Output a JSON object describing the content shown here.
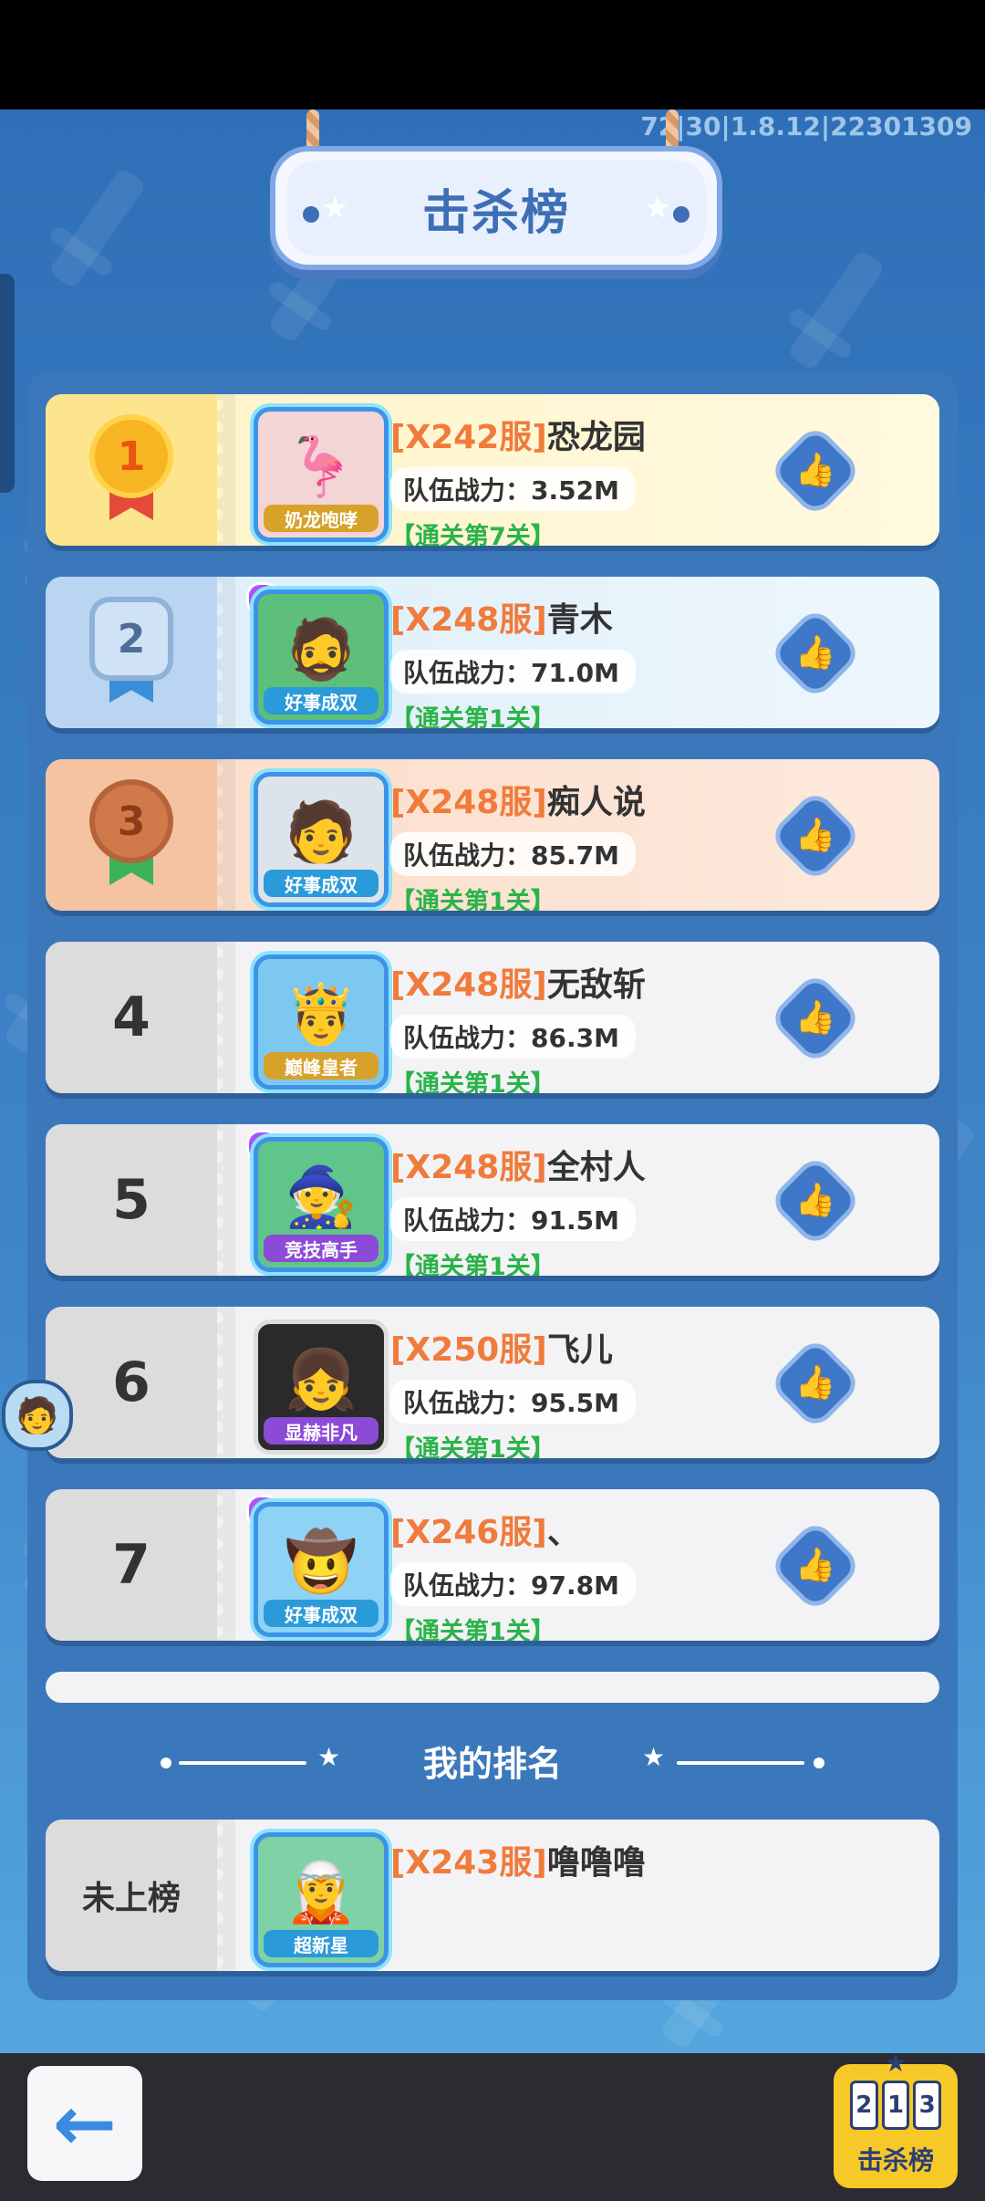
{
  "version": "72|30|1.8.12|22301309",
  "title": "击杀榜",
  "power_prefix": "队伍战力：",
  "rows": [
    {
      "rank": "1",
      "server": "[X242服]",
      "name": "恐龙园",
      "power": "3.52M",
      "stage": "【通关第7关】",
      "badge": "奶龙咆哮",
      "tier": "gold",
      "emoji": "🦩"
    },
    {
      "rank": "2",
      "server": "[X248服]",
      "name": "青木",
      "power": "71.0M",
      "stage": "【通关第1关】",
      "badge": "好事成双",
      "tier": "silver",
      "emoji": "🧔"
    },
    {
      "rank": "3",
      "server": "[X248服]",
      "name": "痴人说",
      "power": "85.7M",
      "stage": "【通关第1关】",
      "badge": "好事成双",
      "tier": "bronze",
      "emoji": "🧑"
    },
    {
      "rank": "4",
      "server": "[X248服]",
      "name": "无敌斩",
      "power": "86.3M",
      "stage": "【通关第1关】",
      "badge": "巅峰皇者",
      "tier": "plain",
      "emoji": "🤴"
    },
    {
      "rank": "5",
      "server": "[X248服]",
      "name": "全村人",
      "power": "91.5M",
      "stage": "【通关第1关】",
      "badge": "竞技高手",
      "tier": "plain",
      "emoji": "🧙"
    },
    {
      "rank": "6",
      "server": "[X250服]",
      "name": "飞儿",
      "power": "95.5M",
      "stage": "【通关第1关】",
      "badge": "显赫非凡",
      "tier": "plain",
      "emoji": "👧"
    },
    {
      "rank": "7",
      "server": "[X246服]",
      "name": "、",
      "power": "97.8M",
      "stage": "【通关第1关】",
      "badge": "好事成双",
      "tier": "plain",
      "emoji": "🤠"
    }
  ],
  "my_rank": {
    "title": "我的排名",
    "rank_text": "未上榜",
    "server": "[X243服]",
    "name": "噜噜噜",
    "badge": "超新星",
    "emoji": "🧝"
  },
  "bottom": {
    "back_icon": "←",
    "kill_label": "击杀榜",
    "podium": [
      "2",
      "1",
      "3"
    ]
  },
  "icons": {
    "like": "👍",
    "back": "back-arrow-icon"
  }
}
